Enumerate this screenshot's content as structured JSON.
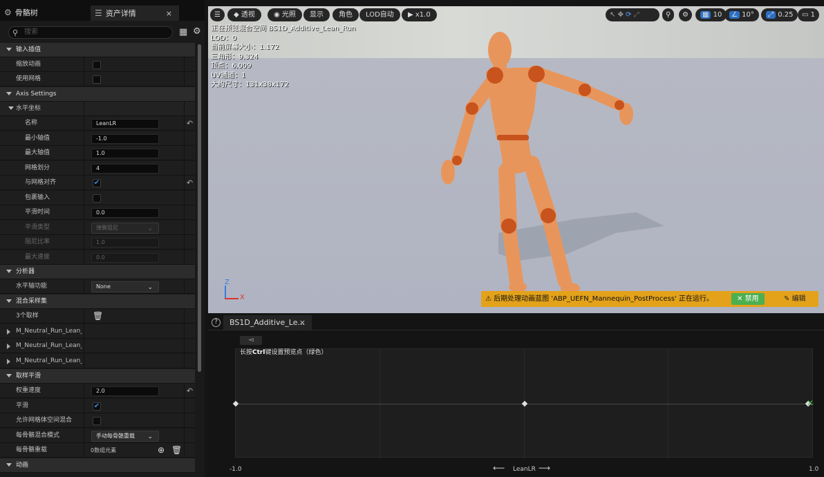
{
  "tabs": [
    {
      "label": "骨骼树",
      "icon": "skeleton-tree-icon"
    },
    {
      "label": "资产详情",
      "icon": "details-icon",
      "close": "×"
    }
  ],
  "search": {
    "placeholder": "搜索"
  },
  "details": {
    "input_interp": "输入插值",
    "scale_anim": "缩放动画",
    "use_grid": "使用网格",
    "axis_settings": "Axis Settings",
    "horizontal": "水平坐标",
    "name_lbl": "名称",
    "name_val": "LeanLR",
    "min_lbl": "最小轴值",
    "min_val": "-1.0",
    "max_lbl": "最大轴值",
    "max_val": "1.0",
    "div_lbl": "网格划分",
    "div_val": "4",
    "snap_lbl": "与网格对齐",
    "wrap_lbl": "包裹输入",
    "smooth_lbl": "平滑时间",
    "smooth_val": "0.0",
    "stype_lbl": "平滑类型",
    "stype_val": "弹簧阻尼",
    "damp_lbl": "阻尼比率",
    "damp_val": "1.0",
    "maxspd_lbl": "最大速度",
    "maxspd_val": "0.0",
    "analyzer": "分析器",
    "h_func_lbl": "水平轴功能",
    "h_func_val": "None",
    "samples_cat": "混合采样集",
    "samples_count": "3个取样",
    "sample_items": [
      "M_Neutral_Run_Lean_Pos",
      "M_Neutral_Run_Lean_Pos",
      "M_Neutral_Run_Lean_Pos"
    ],
    "sample_smooth": "取样平滑",
    "weight_lbl": "权重速度",
    "weight_val": "2.0",
    "smooth2_lbl": "平滑",
    "allow_mesh_lbl": "允许网格体空间混合",
    "blend_mode_lbl": "每骨骼混合模式",
    "blend_mode_val": "手动每骨骼重载",
    "override_lbl": "每骨骼重载",
    "override_val": "0数组元素",
    "anim_cat": "动画"
  },
  "viewport": {
    "buttons": {
      "perspective": "透视",
      "lit": "光照",
      "show": "显示",
      "character": "角色",
      "lod": "LOD自动",
      "speed": "x1.0",
      "grid": "10",
      "angle": "10°",
      "scale": "0.25",
      "camera": "1"
    },
    "stats": [
      "正在预览混合空间 BS1D_Additive_Lean_Run",
      "LOD：0",
      "当前屏幕大小：1.172",
      "三角形：9,324",
      "顶点：6,009",
      "UV通道：1",
      "大约尺寸：131x38x172"
    ],
    "axis": {
      "z": "Z",
      "x": "X"
    },
    "warning": {
      "text": "后期处理动画蓝图 'ABP_UEFN_Mannequin_PostProcess' 正在运行。",
      "disable": "禁用",
      "edit": "编辑"
    }
  },
  "blendspace": {
    "tab": "BS1D_Additive_Le...",
    "tab_close": "×",
    "hint_pre": "长按",
    "hint_key": "Ctrl",
    "hint_post": "键设置预览点（绿色）",
    "x_min": "-1.0",
    "x_max": "1.0",
    "x_label": "LeanLR",
    "axis_min": -1.0,
    "axis_max": 1.0,
    "grid_divisions": 4,
    "sample_points": [
      -1.0,
      0.0,
      1.0
    ],
    "preview_point": 1.0
  },
  "colors": {
    "accent": "#2b6fc4",
    "warning": "#e3a21a",
    "disable_btn": "#4caf50",
    "mannequin": "#e8955c",
    "joint": "#c8531c"
  }
}
